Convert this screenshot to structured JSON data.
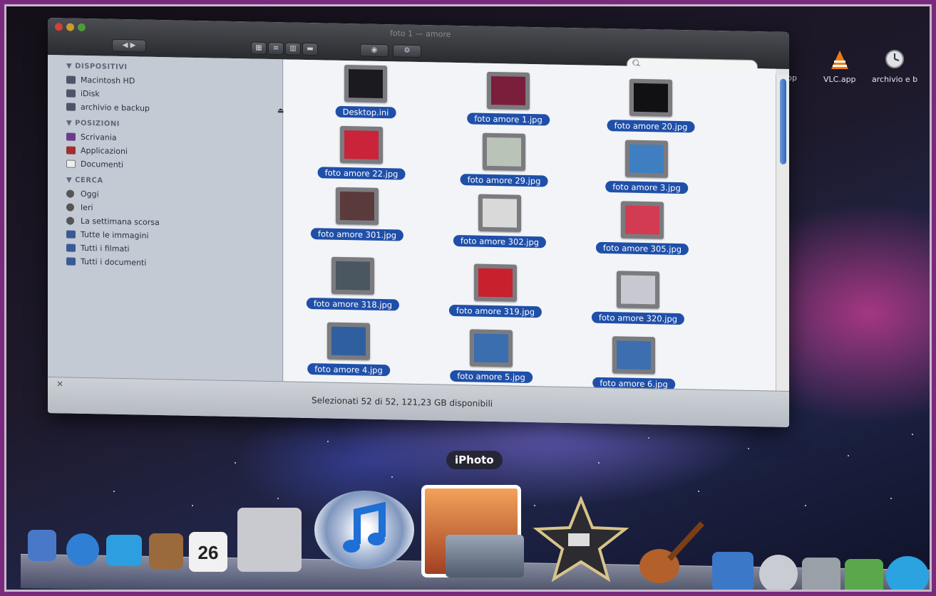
{
  "finder": {
    "title": "foto 1 — amore",
    "sidebar": {
      "sections": [
        {
          "header": "▼ DISPOSITIVI",
          "items": [
            {
              "label": "Macintosh HD",
              "icon": "hard-disk-icon"
            },
            {
              "label": "iDisk",
              "icon": "idisk-icon"
            },
            {
              "label": "archivio e backup",
              "icon": "backup-drive-icon"
            }
          ]
        },
        {
          "header": "▼ POSIZIONI",
          "items": [
            {
              "label": "Scrivania",
              "icon": "desktop-icon"
            },
            {
              "label": "Applicazioni",
              "icon": "applications-icon"
            },
            {
              "label": "Documenti",
              "icon": "documents-icon"
            }
          ]
        },
        {
          "header": "▼ CERCA",
          "items": [
            {
              "label": "Oggi",
              "icon": "clock-icon"
            },
            {
              "label": "Ieri",
              "icon": "clock-icon"
            },
            {
              "label": "La settimana scorsa",
              "icon": "clock-icon"
            },
            {
              "label": "Tutte le immagini",
              "icon": "smart-folder-icon"
            },
            {
              "label": "Tutti i filmati",
              "icon": "smart-folder-icon"
            },
            {
              "label": "Tutti i documenti",
              "icon": "smart-folder-icon"
            }
          ]
        }
      ],
      "eject_symbol": "⏏"
    },
    "files": [
      {
        "name": "Desktop.ini",
        "color": "#1b1b1f"
      },
      {
        "name": "foto amore 1.jpg",
        "color": "#7a1e3c"
      },
      {
        "name": "foto amore 20.jpg",
        "color": "#111114"
      },
      {
        "name": "foto amore 22.jpg",
        "color": "#c9243a"
      },
      {
        "name": "foto amore 29.jpg",
        "color": "#b9c3b8"
      },
      {
        "name": "foto amore 3.jpg",
        "color": "#3f7fc1"
      },
      {
        "name": "foto amore 301.jpg",
        "color": "#5a3a3a"
      },
      {
        "name": "foto amore 302.jpg",
        "color": "#d9d9d9"
      },
      {
        "name": "foto amore 305.jpg",
        "color": "#d33b52"
      },
      {
        "name": "foto amore 318.jpg",
        "color": "#4a5660"
      },
      {
        "name": "foto amore 319.jpg",
        "color": "#c9202d"
      },
      {
        "name": "foto amore 320.jpg",
        "color": "#c8c8d0"
      },
      {
        "name": "foto amore 4.jpg",
        "color": "#2f5f9f"
      },
      {
        "name": "foto amore 5.jpg",
        "color": "#3a6eae"
      },
      {
        "name": "foto amore 6.jpg",
        "color": "#3d6fb0"
      }
    ],
    "status": "Selezionati 52 di 52, 121,23 GB disponibili"
  },
  "desktop_apps": [
    {
      "label": "ule.app",
      "icon": "app-icon"
    },
    {
      "label": "VLC.app",
      "icon": "vlc-cone-icon"
    },
    {
      "label": "archivio e b",
      "icon": "time-machine-icon"
    }
  ],
  "tooltip": "iPhoto",
  "dock": {
    "items": [
      {
        "name": "mail",
        "icon": "mail-icon"
      },
      {
        "name": "safari",
        "icon": "safari-icon"
      },
      {
        "name": "ichat",
        "icon": "ichat-icon"
      },
      {
        "name": "address-book",
        "icon": "address-book-icon"
      },
      {
        "name": "ical",
        "icon": "ical-icon",
        "text": "26"
      },
      {
        "name": "preview",
        "icon": "preview-icon"
      },
      {
        "name": "itunes",
        "icon": "itunes-icon"
      },
      {
        "name": "iphoto",
        "icon": "iphoto-icon"
      },
      {
        "name": "imovie",
        "icon": "imovie-icon"
      },
      {
        "name": "garageband",
        "icon": "garageband-icon"
      },
      {
        "name": "dashboard",
        "icon": "dashboard-icon"
      },
      {
        "name": "time-machine",
        "icon": "time-machine-icon"
      },
      {
        "name": "system-preferences",
        "icon": "system-preferences-icon"
      },
      {
        "name": "messenger",
        "icon": "messenger-icon"
      },
      {
        "name": "skype",
        "icon": "skype-icon"
      }
    ]
  }
}
